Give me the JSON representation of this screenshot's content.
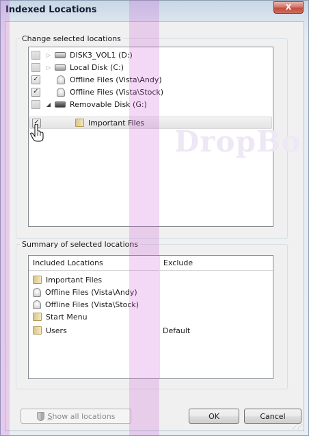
{
  "window": {
    "title": "Indexed Locations",
    "close_glyph": "X"
  },
  "top_group": {
    "legend": "Change selected locations",
    "rows": [
      {
        "label": "DISK3_VOL1 (D:)",
        "checked": false,
        "icon": "drive-icon",
        "expander": "▷"
      },
      {
        "label": "Local Disk (C:)",
        "checked": false,
        "icon": "drive-icon",
        "expander": "▷"
      },
      {
        "label": "Offline Files (Vista\\Andy)",
        "checked": true,
        "icon": "offline-files-icon"
      },
      {
        "label": "Offline Files (Vista\\Stock)",
        "checked": true,
        "icon": "offline-files-icon"
      },
      {
        "label": "Removable Disk (G:)",
        "checked": false,
        "icon": "removable-drive-icon",
        "expander": "◢"
      },
      {
        "label": "Important Files",
        "checked": true,
        "icon": "folder-icon",
        "selected": true
      }
    ]
  },
  "bottom_group": {
    "legend": "Summary of selected locations",
    "columns": {
      "included": "Included Locations",
      "exclude": "Exclude"
    },
    "rows": [
      {
        "label": "Important Files",
        "icon": "folder-icon",
        "exclude": ""
      },
      {
        "label": "Offline Files (Vista\\Andy)",
        "icon": "offline-files-icon",
        "exclude": ""
      },
      {
        "label": "Offline Files (Vista\\Stock)",
        "icon": "offline-files-icon",
        "exclude": ""
      },
      {
        "label": "Start Menu",
        "icon": "folder-icon",
        "exclude": ""
      },
      {
        "label": "Users",
        "icon": "folder-icon",
        "exclude": "Default"
      }
    ]
  },
  "buttons": {
    "show_all": "Show all locations",
    "show_all_mnemonic": "S",
    "show_all_rest": "how all locations",
    "ok": "OK",
    "cancel": "Cancel"
  },
  "check_glyph": "✓",
  "watermark": "DropBo",
  "colors": {
    "accent_magenta": "#c850d2",
    "selection": "#e4e4e4",
    "close_red": "#c0503f"
  }
}
